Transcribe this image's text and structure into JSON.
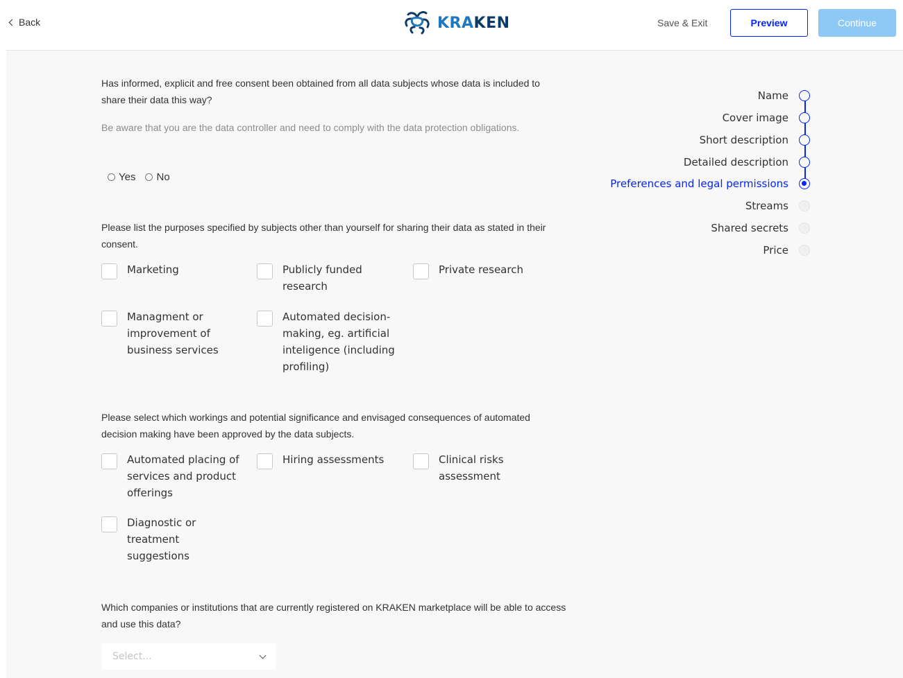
{
  "header": {
    "back_label": "Back",
    "logo_text_a": "KRA",
    "logo_text_b": "KEN",
    "save_exit_label": "Save & Exit",
    "preview_label": "Preview",
    "continue_label": "Continue"
  },
  "consent": {
    "question": "Has informed, explicit and free consent been obtained from all data subjects whose data is included to share their data this way?",
    "hint": "Be aware that you are the data controller and need to comply with the data protection obligations.",
    "options": [
      "Yes",
      "No"
    ]
  },
  "purposes": {
    "question": "Please list the purposes specified by subjects other than yourself for sharing their data as stated in their consent.",
    "items": [
      "Marketing",
      "Publicly funded research",
      "Private research",
      "Managment or improvement of business services",
      "Automated decision-making, eg. artificial inteligence (including profiling)"
    ]
  },
  "automated": {
    "question": "Please select which workings and potential significance and envisaged consequences of automated decision making have been approved by the data subjects.",
    "items": [
      "Automated placing of services and product offerings",
      "Hiring assessments",
      "Clinical risks assessment",
      "Diagnostic or treatment suggestions"
    ]
  },
  "institutions": {
    "question": "Which companies or institutions that are currently registered on KRAKEN marketplace will be able to access and use this data?",
    "select_placeholder": "Select..."
  },
  "steps": [
    {
      "label": "Name",
      "state": "done"
    },
    {
      "label": "Cover image",
      "state": "done"
    },
    {
      "label": "Short description",
      "state": "done"
    },
    {
      "label": "Detailed description",
      "state": "done"
    },
    {
      "label": "Preferences and legal permissions",
      "state": "active"
    },
    {
      "label": "Streams",
      "state": "todo"
    },
    {
      "label": "Shared secrets",
      "state": "todo"
    },
    {
      "label": "Price",
      "state": "todo"
    }
  ],
  "colors": {
    "accent": "#0324ff",
    "continue_disabled": "#8ec8f4",
    "panel_bg": "#f8f8f8"
  }
}
